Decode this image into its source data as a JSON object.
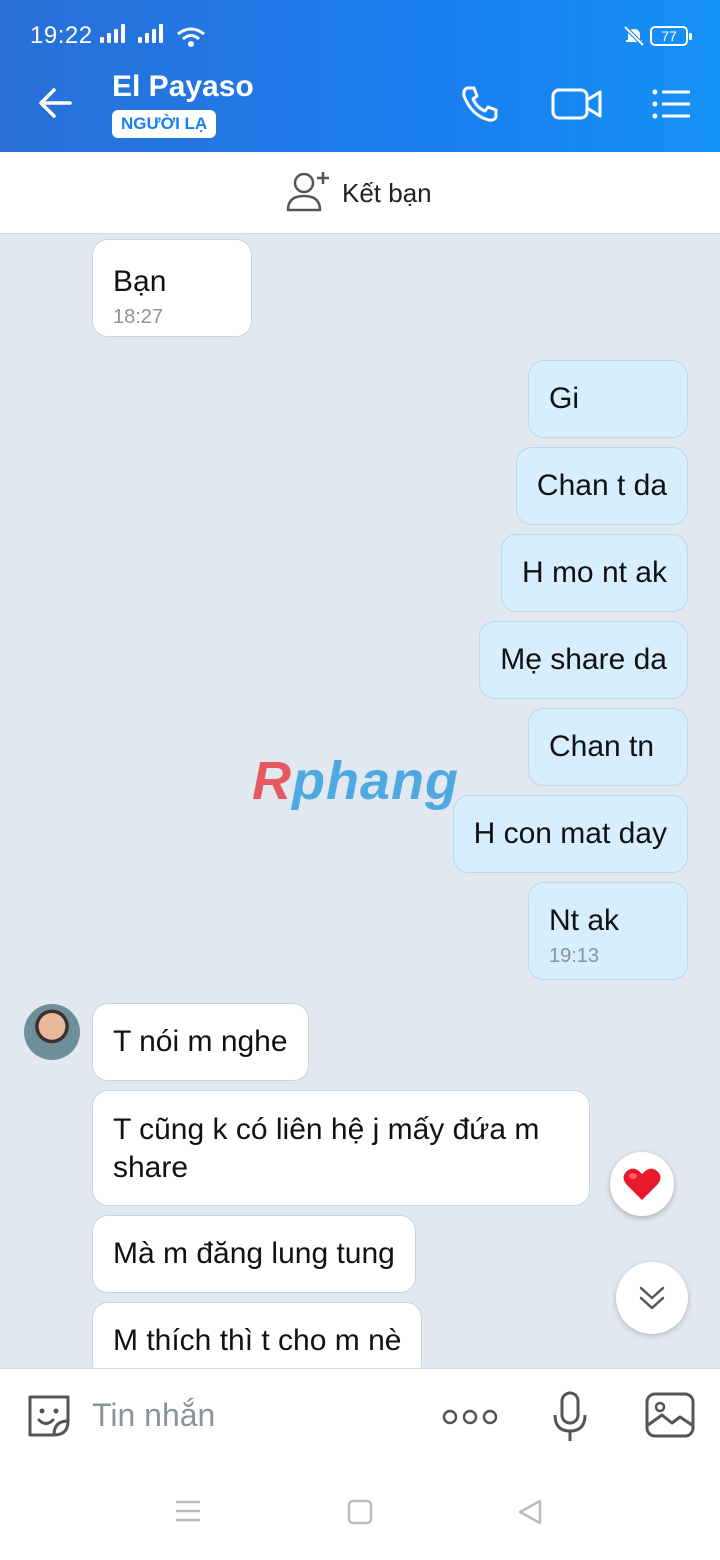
{
  "status_bar": {
    "time": "19:22",
    "battery": "77"
  },
  "header": {
    "contact_name": "El Payaso",
    "badge": "NGƯỜI LẠ"
  },
  "add_friend": {
    "label": "Kết bạn"
  },
  "watermark": {
    "first": "R",
    "rest": "phang"
  },
  "messages": [
    {
      "direction": "in",
      "text": "Bạn",
      "time": "18:27"
    },
    {
      "direction": "out",
      "text": "Gi"
    },
    {
      "direction": "out",
      "text": "Chan t da"
    },
    {
      "direction": "out",
      "text": "H mo nt ak"
    },
    {
      "direction": "out",
      "text": "Mẹ share da"
    },
    {
      "direction": "out",
      "text": "Chan tn"
    },
    {
      "direction": "out",
      "text": "H con mat day"
    },
    {
      "direction": "out",
      "text": "Nt ak",
      "time": "19:13"
    },
    {
      "direction": "in",
      "text": "T nói m nghe"
    },
    {
      "direction": "in",
      "text": "T cũng k có liên hệ j mấy đứa m share"
    },
    {
      "direction": "in",
      "text": "Mà m đăng lung tung"
    },
    {
      "direction": "in",
      "text": "M thích thì t cho m nè"
    }
  ],
  "composer": {
    "placeholder": "Tin nhắn"
  },
  "icons": {
    "back": "arrow-left-icon",
    "call": "phone-icon",
    "video": "video-camera-icon",
    "menu": "list-menu-icon",
    "add_friend": "add-user-icon",
    "sticker": "sticker-face-icon",
    "more": "more-dots-icon",
    "mic": "microphone-icon",
    "image": "image-icon",
    "reaction": "heart-icon",
    "scroll": "double-chevron-down-icon"
  },
  "colors": {
    "header": "#1a7ff0",
    "outgoing_bubble": "#d6eefe",
    "incoming_bubble": "#ffffff",
    "chat_bg": "#e2e8ef",
    "reaction_heart": "#e8192c"
  }
}
